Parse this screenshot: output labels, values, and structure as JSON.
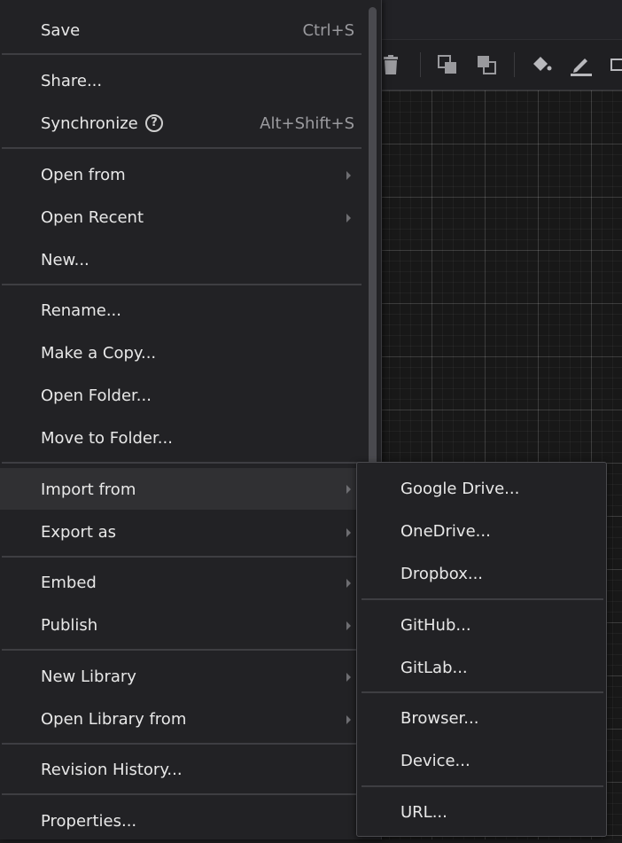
{
  "menu": {
    "save": {
      "label": "Save",
      "shortcut": "Ctrl+S"
    },
    "share": {
      "label": "Share..."
    },
    "synchronize": {
      "label": "Synchronize",
      "shortcut": "Alt+Shift+S",
      "help_icon": "?"
    },
    "open_from": {
      "label": "Open from"
    },
    "open_recent": {
      "label": "Open Recent"
    },
    "new": {
      "label": "New..."
    },
    "rename": {
      "label": "Rename..."
    },
    "make_copy": {
      "label": "Make a Copy..."
    },
    "open_folder": {
      "label": "Open Folder..."
    },
    "move_to_folder": {
      "label": "Move to Folder..."
    },
    "import_from": {
      "label": "Import from"
    },
    "export_as": {
      "label": "Export as"
    },
    "embed": {
      "label": "Embed"
    },
    "publish": {
      "label": "Publish"
    },
    "new_library": {
      "label": "New Library"
    },
    "open_library_from": {
      "label": "Open Library from"
    },
    "revision_history": {
      "label": "Revision History..."
    },
    "properties": {
      "label": "Properties..."
    }
  },
  "submenu": {
    "google_drive": "Google Drive...",
    "onedrive": "OneDrive...",
    "dropbox": "Dropbox...",
    "github": "GitHub...",
    "gitlab": "GitLab...",
    "browser": "Browser...",
    "device": "Device...",
    "url": "URL..."
  },
  "icons": {
    "delete": "trash-icon",
    "to_front": "to-front-icon",
    "to_back": "to-back-icon",
    "fill": "fill-color-icon",
    "line": "line-color-icon"
  },
  "colors": {
    "menu_bg": "#222225",
    "hover_bg": "#303033",
    "text": "#e8e8e8",
    "shortcut": "#9a9a9e"
  }
}
